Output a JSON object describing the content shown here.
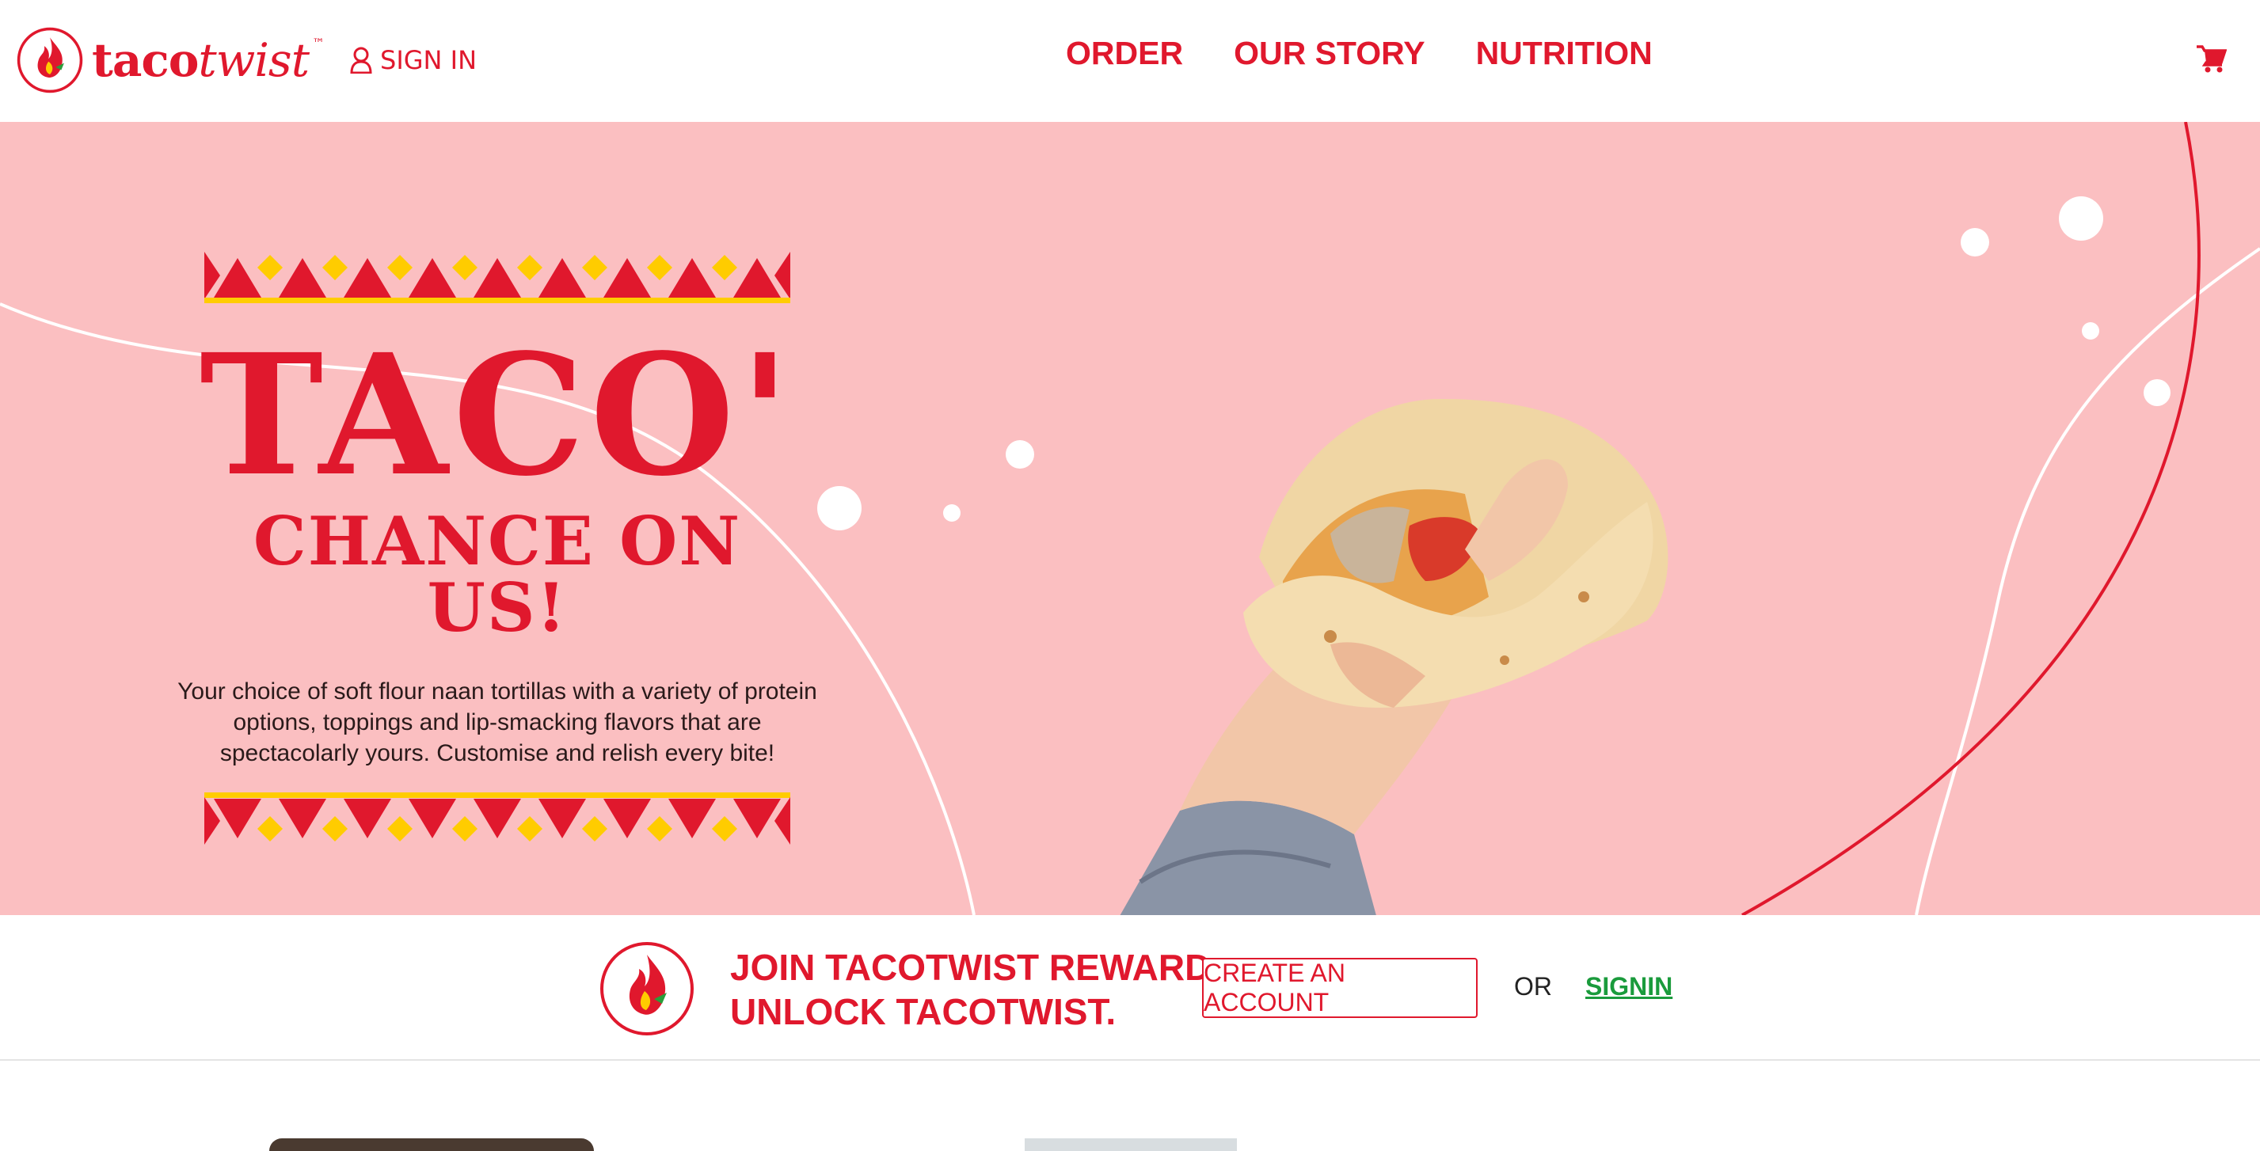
{
  "header": {
    "logo_text_bold": "taco",
    "logo_text_light": "twist",
    "logo_tm": "™",
    "signin_label": "SIGN IN",
    "nav": [
      "ORDER",
      "OUR STORY",
      "NUTRITION"
    ],
    "cart_icon": "cart-icon"
  },
  "hero": {
    "title": "TACO'",
    "subtitle": "CHANCE ON US!",
    "description": "Your choice of soft flour naan tortillas with a variety of protein options, toppings and lip-smacking flavors that are spectacolarly yours. Customise and relish every bite!"
  },
  "reward": {
    "line1": "JOIN TACOTWIST REWARD.",
    "line2": "UNLOCK TACOTWIST.",
    "create_label": "CREATE AN ACCOUNT",
    "or_label": "OR",
    "signin_label": "SIGNIN"
  },
  "colors": {
    "brand_red": "#e0182d",
    "hero_pink": "#fbbfc1",
    "accent_yellow": "#ffcc00",
    "link_green": "#1a9b3c"
  }
}
